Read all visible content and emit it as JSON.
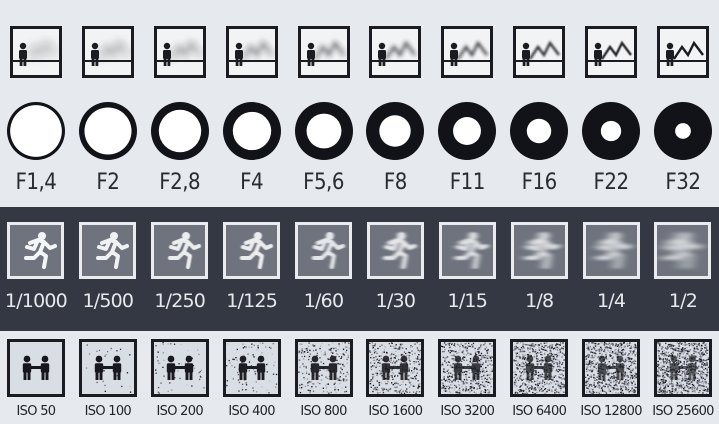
{
  "aperture": {
    "labels": [
      "F1,4",
      "F2",
      "F2,8",
      "F4",
      "F5,6",
      "F8",
      "F11",
      "F16",
      "F22",
      "F32"
    ],
    "background_blur": [
      1.0,
      0.9,
      0.78,
      0.66,
      0.54,
      0.42,
      0.3,
      0.2,
      0.1,
      0.0
    ],
    "ring_thickness": [
      0.04,
      0.12,
      0.2,
      0.27,
      0.33,
      0.39,
      0.45,
      0.51,
      0.58,
      0.66
    ]
  },
  "shutter": {
    "labels": [
      "1/1000",
      "1/500",
      "1/250",
      "1/125",
      "1/60",
      "1/30",
      "1/15",
      "1/8",
      "1/4",
      "1/2"
    ],
    "motion_blur": [
      0.0,
      0.05,
      0.1,
      0.18,
      0.28,
      0.4,
      0.55,
      0.7,
      0.85,
      1.0
    ]
  },
  "iso": {
    "labels": [
      "ISO 50",
      "ISO 100",
      "ISO 200",
      "ISO 400",
      "ISO 800",
      "ISO 1600",
      "ISO 3200",
      "ISO 6400",
      "ISO 12800",
      "ISO 25600"
    ],
    "noise_level": [
      0.0,
      0.03,
      0.06,
      0.1,
      0.25,
      0.4,
      0.55,
      0.7,
      0.85,
      1.0
    ]
  },
  "colors": {
    "page_bg": "#e6e9ee",
    "band_bg": "#343842",
    "ink": "#1a1c22",
    "light_ink": "#e9ebef"
  }
}
